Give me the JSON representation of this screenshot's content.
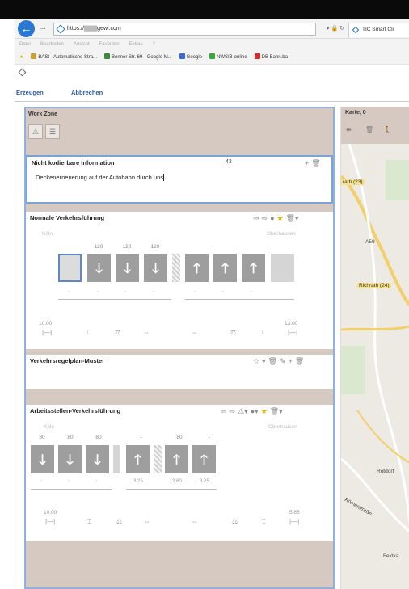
{
  "browser": {
    "url_host": "https://",
    "url_domain": "gewi.com",
    "tab_title": "TIC Smart Cli",
    "menu": [
      "Datei",
      "Bearbeiten",
      "Ansicht",
      "Favoriten",
      "Extras",
      "?"
    ],
    "favorites": [
      {
        "label": "BASt - Automatische Stra...",
        "color": "#c8a03a"
      },
      {
        "label": "Bonner Str. 69 - Google M...",
        "color": "#3a8a3a"
      },
      {
        "label": "Google",
        "color": "#3a6ad8"
      },
      {
        "label": "NWSIB-online",
        "color": "#3aa83a"
      },
      {
        "label": "DB Bahn.ba",
        "color": "#d82a2a"
      }
    ]
  },
  "commands": {
    "create": "Erzeugen",
    "cancel": "Abbrechen"
  },
  "workzone": {
    "title": "Work Zone",
    "info": {
      "title": "Nicht kodierbare Information",
      "count": "43",
      "text": "Deckenerneuerung auf der Autobahn durch uns"
    },
    "normal": {
      "title": "Normale Verkehrsführung",
      "city_left": "Köln",
      "city_right": "Oberhausen",
      "speeds": [
        "120",
        "120",
        "120"
      ],
      "time_left": "10.00",
      "time_right": "13.00"
    },
    "pattern": {
      "title": "Verkehrsregelplan-Muster"
    },
    "work": {
      "title": "Arbeitsstellen-Verkehrsführung",
      "city_left": "Köln",
      "city_right": "Oberhausen",
      "speeds": [
        "80",
        "80",
        "80",
        "-",
        "80",
        "-"
      ],
      "widths": [
        "3.25",
        "2.60",
        "3.25"
      ],
      "time_left": "10.00",
      "time_right": "5.85"
    }
  },
  "map": {
    "title": "Karte, 0",
    "labels": [
      "rath (23)",
      "A59",
      "Richrath (24)",
      "Rotdorf",
      "Römerstraße",
      "Feldka"
    ]
  }
}
